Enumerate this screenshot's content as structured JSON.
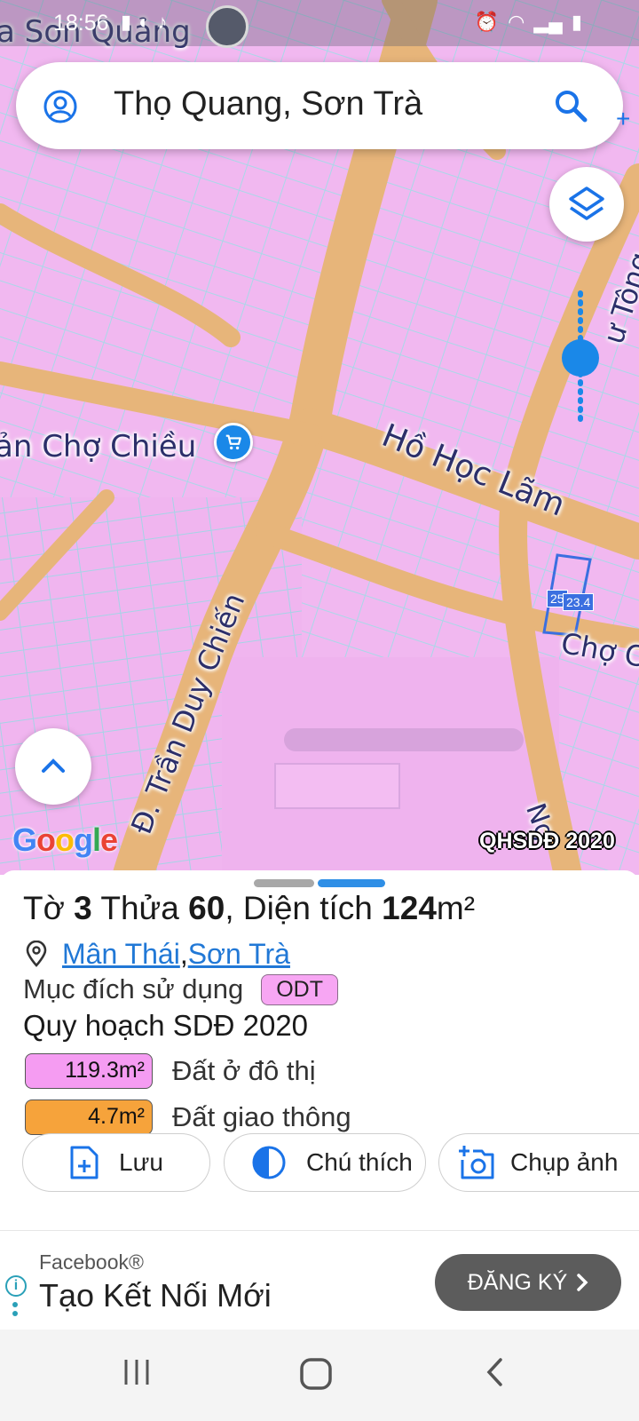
{
  "status_bar": {
    "time": "18:56"
  },
  "search": {
    "text": "Thọ Quang, Sơn Trà"
  },
  "map": {
    "labels": {
      "corner_place": "a Sơn Quảng",
      "market": "ản Chợ Chiều",
      "street_ho_hoc_lam": "Hồ Học Lãm",
      "street_tran_duy_chien": "Đ. Trần Duy Chiến",
      "street_cho": "Chợ C",
      "street_tong": "ư Tông",
      "street_ng": "Ng"
    },
    "parcel_numbers": [
      "25",
      "23.4"
    ],
    "badge": "QHSDĐ 2020",
    "google_logo": "Google"
  },
  "parcel": {
    "sheet_prefix": "Tờ ",
    "sheet": "3",
    "plot_prefix": " Thửa ",
    "plot": "60",
    "area_prefix": ", Diện tích ",
    "area": "124",
    "area_unit": "m²",
    "ward": "Mân Thái",
    "separator": ", ",
    "district": "Sơn Trà",
    "purpose_label": "Mục đích sử dụng",
    "purpose_code": "ODT",
    "plan_title": "Quy hoạch SDĐ 2020",
    "zones": [
      {
        "area": "119.3m²",
        "label": "Đất ở đô thị",
        "color": "#f59cf2"
      },
      {
        "area": "4.7m²",
        "label": "Đất giao thông",
        "color": "#f6a33b"
      }
    ]
  },
  "actions": {
    "save": "Lưu",
    "legend": "Chú thích",
    "capture": "Chụp ảnh"
  },
  "ad": {
    "brand": "Facebook®",
    "title": "Tạo Kết Nối Mới",
    "cta": "ĐĂNG KÝ"
  },
  "colors": {
    "accent": "#1a73e8",
    "map_pink": "#f1b7f0",
    "road_orange": "#e9b778",
    "parcel_line": "#9fd4e6"
  }
}
